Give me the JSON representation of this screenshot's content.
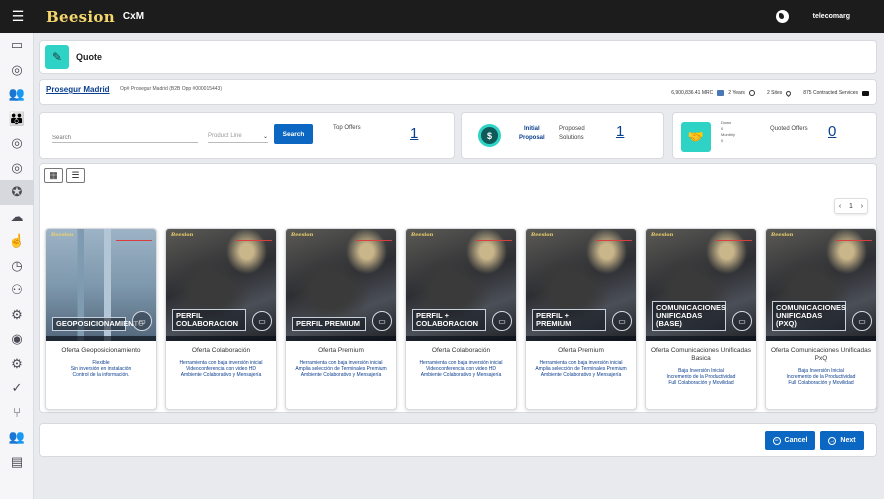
{
  "app": {
    "brand": "Beesion",
    "brand_sub": "CxM",
    "user": "telecomarg",
    "menu_icon": "hamburger-icon",
    "globe_icon": "globe-icon"
  },
  "sidebar": {
    "items": [
      {
        "icon": "window-icon",
        "glyph": "▭"
      },
      {
        "icon": "target-icon",
        "glyph": "◎"
      },
      {
        "icon": "customers-icon",
        "glyph": "👥"
      },
      {
        "icon": "groups-icon",
        "glyph": "👪"
      },
      {
        "icon": "goal-icon",
        "glyph": "◎"
      },
      {
        "icon": "campaign-icon",
        "glyph": "◎"
      },
      {
        "icon": "offers-icon",
        "glyph": "✪",
        "active": true
      },
      {
        "icon": "upload-icon",
        "glyph": "☁"
      },
      {
        "icon": "hand-icon",
        "glyph": "☝"
      },
      {
        "icon": "clock-icon",
        "glyph": "◷"
      },
      {
        "icon": "team-icon",
        "glyph": "⚇"
      },
      {
        "icon": "settings-icon",
        "glyph": "⚙"
      },
      {
        "icon": "locate-icon",
        "glyph": "◉"
      },
      {
        "icon": "gear-icon",
        "glyph": "⚙"
      },
      {
        "icon": "assign-icon",
        "glyph": "✓"
      },
      {
        "icon": "flow-icon",
        "glyph": "⑂"
      },
      {
        "icon": "partners-icon",
        "glyph": "👥"
      },
      {
        "icon": "docs-icon",
        "glyph": "▤"
      }
    ]
  },
  "header": {
    "title": "Quote",
    "icon": "pencil-icon"
  },
  "account": {
    "name": "Prosegur Madrid",
    "opportunity": "Op# Prosegur Madrid (B2B Opp #000015443)",
    "mrc": "6,900,836.41 MRC",
    "years": "2 Years",
    "sites": "2 Sites",
    "services": "875 Contracted Services"
  },
  "search": {
    "placeholder": "Search",
    "product_line": "Product Line",
    "button": "Search",
    "top_offers_label": "Top Offers",
    "top_offers_count": "1"
  },
  "initial": {
    "icon_text": "$",
    "label_line1": "Initial",
    "label_line2": "Proposal",
    "proposed_line1": "Proposed",
    "proposed_line2": "Solutions",
    "proposed_count": "1"
  },
  "quoted": {
    "down_label": "Down",
    "down_value": "0",
    "monthly_label": "Monthly",
    "monthly_value": "0",
    "label": "Quoted Offers",
    "count": "0"
  },
  "pager": {
    "page": "1"
  },
  "offers": [
    {
      "image_title": "GEOPOSICIONAMIENTO",
      "image": "city",
      "name": "Oferta Geoposicionamiento",
      "desc": [
        "Flexible",
        "Sin inversión en instalación",
        "Control de la información."
      ]
    },
    {
      "image_title": "PERFIL COLABORACION",
      "image": "man",
      "name": "Oferta Colaboración",
      "desc": [
        "Herramienta con baja inversión inicial",
        "Videoconferencia con video HD",
        "Ambiente Colaborativo y Mensajería"
      ]
    },
    {
      "image_title": "PERFIL PREMIUM",
      "image": "man",
      "name": "Oferta Premium",
      "desc": [
        "Herramienta con baja inversión inicial",
        "Amplia selección de Terminales Premium",
        "Ambiente Colaborativo y Mensajería"
      ]
    },
    {
      "image_title": "PERFIL + COLABORACION",
      "image": "man",
      "name": "Oferta Colaboración",
      "desc": [
        "Herramienta con baja inversión inicial",
        "Videoconferencia con video HD",
        "Ambiente Colaborativo y Mensajería"
      ]
    },
    {
      "image_title": "PERFIL + PREMIUM",
      "image": "man",
      "name": "Oferta Premium",
      "desc": [
        "Herramienta con baja inversión inicial",
        "Amplia selección de Terminales Premium",
        "Ambiente Colaborativo y Mensajería"
      ]
    },
    {
      "image_title": "COMUNICACIONES UNIFICADAS (Base)",
      "image": "man",
      "name": "Oferta Comunicaciones Unificadas Basica",
      "desc": [
        "Baja Inversión Inicial",
        "Incremento de la Productividad",
        "Full Colaboración y Movilidad"
      ]
    },
    {
      "image_title": "COMUNICACIONES UNIFICADAS (PxQ)",
      "image": "man",
      "name": "Oferta Comunicaciones Unificadas PxQ",
      "desc": [
        "Baja Inversión Inicial",
        "Incremento de la Productividad",
        "Full Colaboración y Movilidad"
      ]
    }
  ],
  "footer": {
    "cancel": "Cancel",
    "next": "Next"
  },
  "colors": {
    "accent": "#2ed3c6",
    "primary": "#0b67c2",
    "link": "#0b3f8f",
    "topbar": "#1c1c1c"
  }
}
